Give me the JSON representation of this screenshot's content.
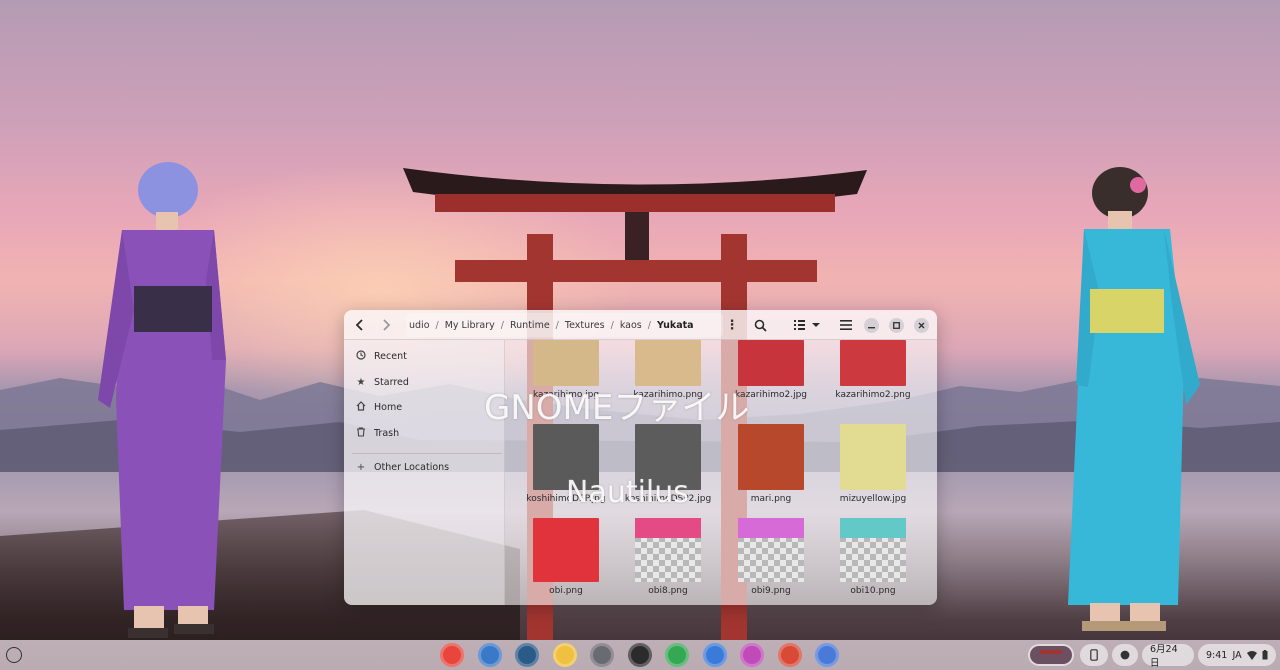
{
  "window": {
    "breadcrumb": [
      "udio",
      "My Library",
      "Runtime",
      "Textures",
      "kaos",
      "Yukata"
    ],
    "breadcrumb_separator": "/",
    "icons": {
      "back": "chevron-left-icon",
      "forward": "chevron-right-icon",
      "path_menu": "vertical-dots-icon",
      "search": "search-icon",
      "view": "list-view-icon",
      "view_options": "chevron-down-icon",
      "main_menu": "hamburger-icon",
      "minimize": "minimize-icon",
      "maximize": "maximize-icon",
      "close": "close-icon"
    }
  },
  "sidebar": {
    "items": [
      {
        "label": "Recent",
        "icon": "clock-icon"
      },
      {
        "label": "Starred",
        "icon": "star-icon"
      },
      {
        "label": "Home",
        "icon": "home-icon"
      },
      {
        "label": "Trash",
        "icon": "trash-icon"
      }
    ],
    "other_locations": {
      "label": "Other Locations",
      "icon": "plus-icon"
    }
  },
  "files": [
    {
      "name": "kazarihimo.jpg",
      "color": "#d4b88a"
    },
    {
      "name": "kazarihimo.png",
      "color": "#d8ba8c"
    },
    {
      "name": "kazarihimo2.jpg",
      "color": "#c8343c"
    },
    {
      "name": "kazarihimo2.png",
      "color": "#cc3a40"
    },
    {
      "name": "koshihimoDSP.jpg",
      "color": "#5a5a5a"
    },
    {
      "name": "koshihimoDSP2.jpg",
      "color": "#5c5c5c"
    },
    {
      "name": "mari.png",
      "color": "#b8482c"
    },
    {
      "name": "mizuyellow.jpg",
      "color": "#e2dc92"
    },
    {
      "name": "obi.png",
      "color": "#e0333c"
    },
    {
      "name": "obi8.png",
      "color": "#e44a86"
    },
    {
      "name": "obi9.png",
      "color": "#d66ad6"
    },
    {
      "name": "obi10.png",
      "color": "#62c8c8"
    }
  ],
  "watermark": {
    "line1": "GNOMEファイル",
    "line2": "Nautilus"
  },
  "shelf": {
    "launcher_icon": "launcher-circle-icon",
    "apps": [
      {
        "name": "chrome-icon",
        "color": "#e8453c"
      },
      {
        "name": "files-icon",
        "color": "#3a78c8"
      },
      {
        "name": "settings-icon",
        "color": "#2a5a88"
      },
      {
        "name": "photos-icon",
        "color": "#f0c040"
      },
      {
        "name": "code-editor-icon",
        "color": "#6a6a72"
      },
      {
        "name": "terminal-icon",
        "color": "#2b2b2b"
      },
      {
        "name": "play-store-icon",
        "color": "#34a853"
      },
      {
        "name": "web-app-icon",
        "color": "#3a7ad8"
      },
      {
        "name": "studio-icon",
        "color": "#c04ab8"
      },
      {
        "name": "remote-desktop-icon",
        "color": "#d84a36"
      },
      {
        "name": "docs-icon",
        "color": "#4a7ad8"
      }
    ],
    "tray": {
      "date": "6月24日",
      "time": "9:41",
      "ime": "JA"
    }
  }
}
